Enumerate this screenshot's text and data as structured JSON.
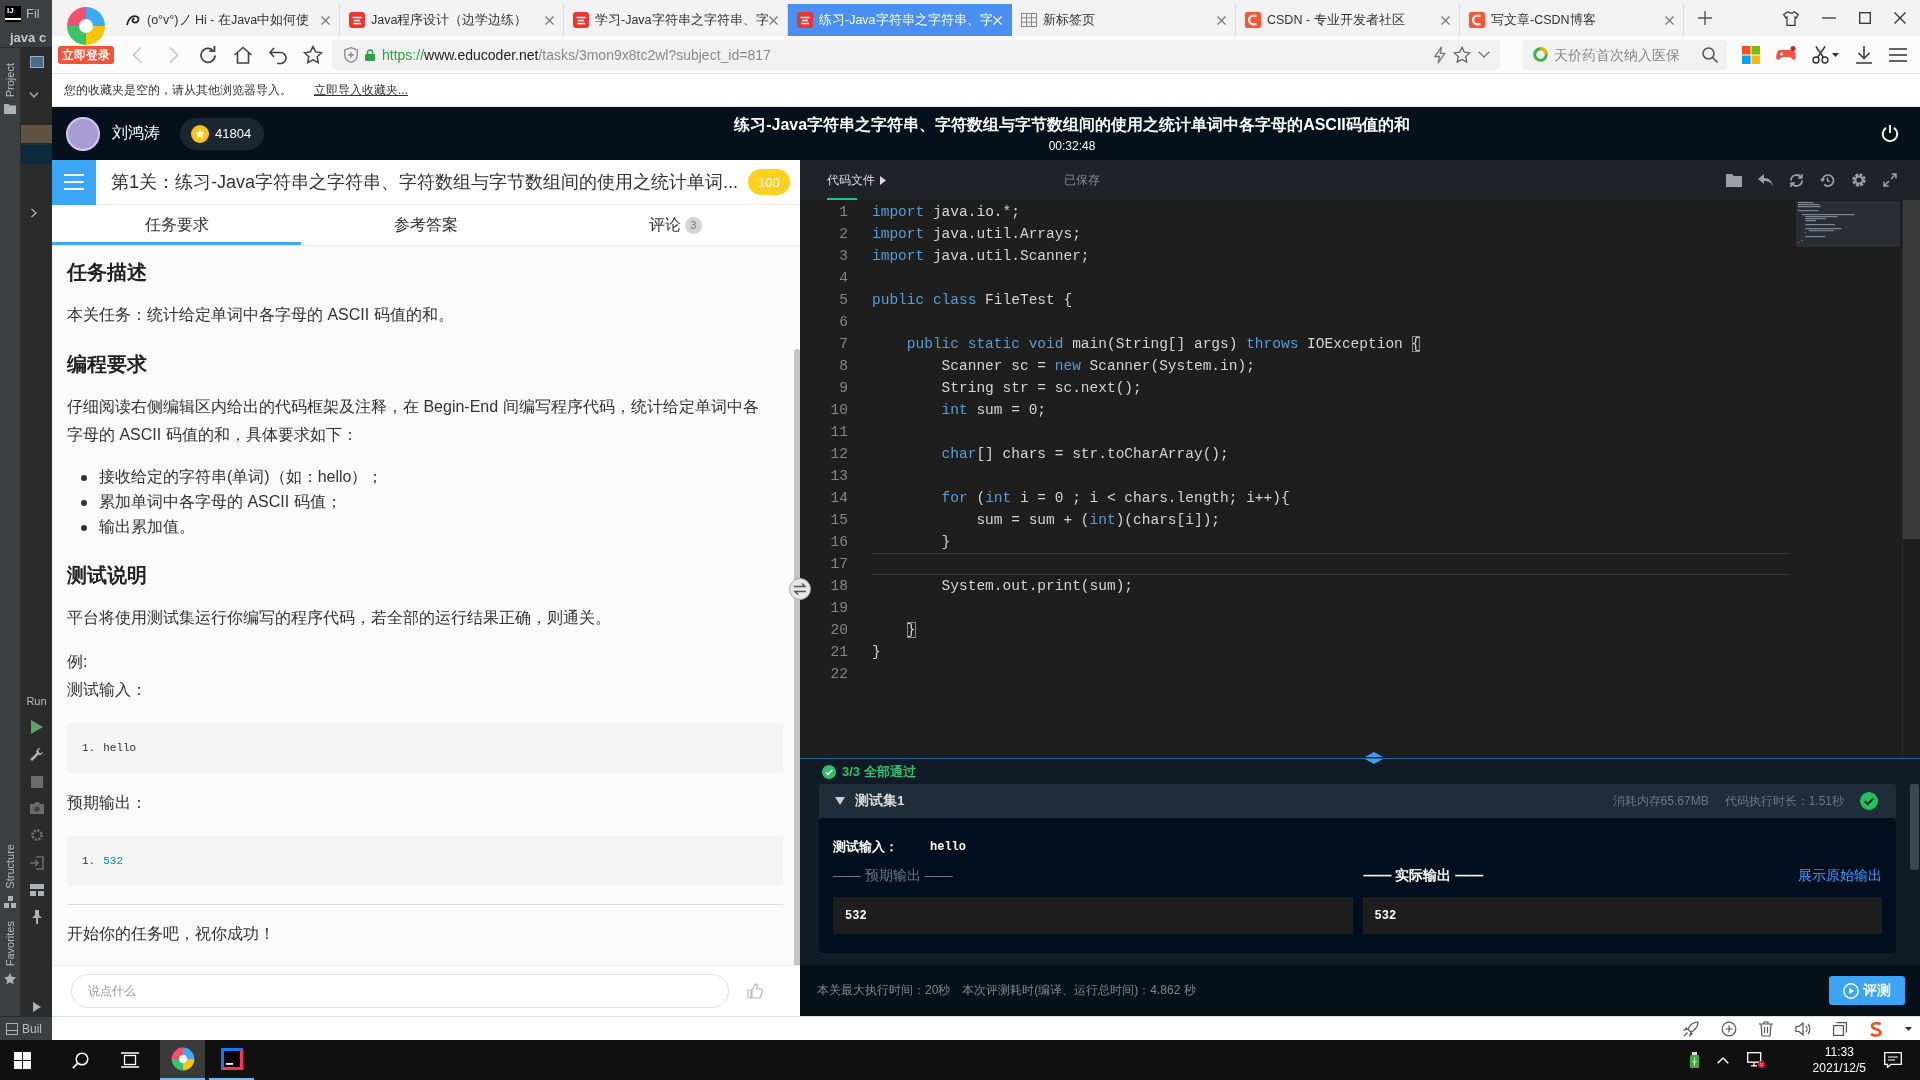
{
  "ide": {
    "logo": "IJ",
    "menu": "Fil",
    "project": "java c",
    "tool_tabs": [
      {
        "label": "Project",
        "kind": "top"
      },
      {
        "label": "Structure",
        "kind": "bottom"
      },
      {
        "label": "Favorites",
        "kind": "bottom"
      }
    ],
    "run_label": "Run",
    "build_label": "Buil"
  },
  "browser": {
    "login": "立即登录",
    "tabs": [
      {
        "title": "(o°v°)ノ Hi - 在Java中如何使",
        "kind": "blog",
        "selected": false
      },
      {
        "title": "Java程序设计（边学边练）",
        "kind": "news",
        "selected": false
      },
      {
        "title": "学习-Java字符串之字符串、字",
        "kind": "news",
        "selected": false
      },
      {
        "title": "练习-Java字符串之字符串、字",
        "kind": "news",
        "selected": true
      },
      {
        "title": "新标签页",
        "kind": "blank",
        "selected": false
      },
      {
        "title": "CSDN - 专业开发者社区",
        "kind": "csdn",
        "selected": false
      },
      {
        "title": "写文章-CSDN博客",
        "kind": "csdn",
        "selected": false
      }
    ],
    "navigation": {
      "back_disabled": true,
      "forward_disabled": true
    },
    "url": {
      "scheme": "https://",
      "host": "www.educoder.net",
      "path": "/tasks/3mon9x8tc2wl?subject_id=817"
    },
    "search": {
      "placeholder": "天价药首次纳入医保"
    },
    "bookmarks": {
      "message": "您的收藏夹是空的，请从其他浏览器导入。",
      "link": "立即导入收藏夹..."
    }
  },
  "header": {
    "user": "刘鸿涛",
    "coins": "41804",
    "title": "练习-Java字符串之字符串、字符数组与字节数组间的使用之统计单词中各字母的ASCII码值的和",
    "timer": "00:32:48"
  },
  "task": {
    "title": "第1关：练习-Java字符串之字符串、字符数组与字节数组间的使用之统计单词...",
    "score": "100",
    "tabs": [
      {
        "label": "任务要求",
        "selected": true
      },
      {
        "label": "参考答案",
        "selected": false
      },
      {
        "label": "评论",
        "count": "3",
        "selected": false
      }
    ],
    "content": [
      {
        "kind": "heading",
        "text": "任务描述"
      },
      {
        "kind": "paragraph",
        "text": "本关任务：统计给定单词中各字母的 ASCII 码值的和。"
      },
      {
        "kind": "heading",
        "text": "编程要求"
      },
      {
        "kind": "paragraph",
        "text": "仔细阅读右侧编辑区内给出的代码框架及注释，在 Begin-End 间编写程序代码，统计给定单词中各字母的 ASCII 码值的和，具体要求如下："
      },
      {
        "kind": "list",
        "items": [
          "接收给定的字符串(单词)（如：hello）；",
          "累加单词中各字母的 ASCII 码值；",
          "输出累加值。"
        ]
      },
      {
        "kind": "heading",
        "text": "测试说明"
      },
      {
        "kind": "paragraph",
        "text": "平台将使用测试集运行你编写的程序代码，若全部的运行结果正确，则通关。"
      },
      {
        "kind": "label",
        "text": "例:"
      },
      {
        "kind": "label",
        "text": "测试输入："
      },
      {
        "kind": "code",
        "lines": [
          {
            "number": "1.",
            "text": "hello",
            "kind": "plain"
          }
        ]
      },
      {
        "kind": "label",
        "text": "预期输出："
      },
      {
        "kind": "code",
        "lines": [
          {
            "number": "1.",
            "text": "532",
            "kind": "number"
          }
        ]
      },
      {
        "kind": "rule"
      },
      {
        "kind": "paragraph",
        "text": "开始你的任务吧，祝你成功！"
      }
    ],
    "comment": {
      "placeholder": "说点什么"
    }
  },
  "editor": {
    "file_tab": "代码文件",
    "save_status": "已保存",
    "lines": [
      {
        "number": "1",
        "current": false,
        "bracket_match": false,
        "tokens": [
          {
            "kind": "keyword",
            "text": "import"
          },
          {
            "kind": "plain",
            "text": " java.io.*;"
          }
        ]
      },
      {
        "number": "2",
        "current": false,
        "bracket_match": false,
        "tokens": [
          {
            "kind": "keyword",
            "text": "import"
          },
          {
            "kind": "plain",
            "text": " java.util.Arrays;"
          }
        ]
      },
      {
        "number": "3",
        "current": false,
        "bracket_match": false,
        "tokens": [
          {
            "kind": "keyword",
            "text": "import"
          },
          {
            "kind": "plain",
            "text": " java.util.Scanner;"
          }
        ]
      },
      {
        "number": "4",
        "current": false
      },
      {
        "number": "5",
        "current": false,
        "bracket_match": false,
        "tokens": [
          {
            "kind": "keyword",
            "text": "public class"
          },
          {
            "kind": "plain",
            "text": " FileTest {"
          }
        ]
      },
      {
        "number": "6",
        "current": false
      },
      {
        "number": "7",
        "current": false,
        "bracket_match": true,
        "tokens": [
          {
            "kind": "keyword",
            "text": "    public static void"
          },
          {
            "kind": "plain",
            "text": " main(String[] args) "
          },
          {
            "kind": "keyword",
            "text": "throws"
          },
          {
            "kind": "plain",
            "text": " IOException {"
          }
        ]
      },
      {
        "number": "8",
        "current": false,
        "bracket_match": false,
        "tokens": [
          {
            "kind": "plain",
            "text": "        Scanner sc = "
          },
          {
            "kind": "keyword",
            "text": "new"
          },
          {
            "kind": "plain",
            "text": " Scanner(System.in);"
          }
        ]
      },
      {
        "number": "9",
        "current": false,
        "bracket_match": false,
        "tokens": [
          {
            "kind": "plain",
            "text": "        String str = sc.next();"
          }
        ]
      },
      {
        "number": "10",
        "current": false,
        "bracket_match": false,
        "tokens": [
          {
            "kind": "keyword",
            "text": "        int"
          },
          {
            "kind": "plain",
            "text": " sum = 0;"
          }
        ]
      },
      {
        "number": "11",
        "current": false
      },
      {
        "number": "12",
        "current": false,
        "bracket_match": false,
        "tokens": [
          {
            "kind": "keyword",
            "text": "        char"
          },
          {
            "kind": "plain",
            "text": "[] chars = str.toCharArray();"
          }
        ]
      },
      {
        "number": "13",
        "current": false
      },
      {
        "number": "14",
        "current": false,
        "bracket_match": false,
        "tokens": [
          {
            "kind": "keyword",
            "text": "        for"
          },
          {
            "kind": "plain",
            "text": " ("
          },
          {
            "kind": "keyword",
            "text": "int"
          },
          {
            "kind": "plain",
            "text": " i = 0 ; i < chars.length; i++){"
          }
        ]
      },
      {
        "number": "15",
        "current": false,
        "bracket_match": false,
        "tokens": [
          {
            "kind": "plain",
            "text": "            sum = sum + ("
          },
          {
            "kind": "keyword",
            "text": "int"
          },
          {
            "kind": "plain",
            "text": ")(chars[i]);"
          }
        ]
      },
      {
        "number": "16",
        "current": false,
        "bracket_match": false,
        "tokens": [
          {
            "kind": "plain",
            "text": "        }"
          }
        ]
      },
      {
        "number": "17",
        "current": true
      },
      {
        "number": "18",
        "current": false,
        "bracket_match": false,
        "tokens": [
          {
            "kind": "plain",
            "text": "        System.out.print(sum);"
          }
        ]
      },
      {
        "number": "19",
        "current": false
      },
      {
        "number": "20",
        "current": false,
        "bracket_match": true,
        "tokens": [
          {
            "kind": "plain",
            "text": "    }"
          }
        ]
      },
      {
        "number": "21",
        "current": false,
        "bracket_match": false,
        "tokens": [
          {
            "kind": "plain",
            "text": "}"
          }
        ]
      },
      {
        "number": "22",
        "current": false
      }
    ]
  },
  "results": {
    "summary": "3/3 全部通过",
    "passed": true,
    "test_sets": [
      {
        "name": "测试集1",
        "expanded": true,
        "passed": true,
        "memory": "消耗内存65.67MB",
        "duration": "代码执行时长：1.51秒",
        "input_label": "测试输入：",
        "input": "hello",
        "expected_label": "—— 预期输出 ——",
        "actual_label": "—— 实际输出 ——",
        "raw_link": "展示原始输出",
        "expected": "532",
        "actual": "532"
      }
    ],
    "time_limit": "本关最大执行时间：20秒",
    "elapsed": "本次评测耗时(编译、运行总时间)：4.862 秒",
    "evaluate": "评测"
  },
  "taskbar": {
    "apps": [
      {
        "kind": "browser",
        "focused": true
      },
      {
        "kind": "ide",
        "focused": false
      }
    ],
    "time": "11:33",
    "date": "2021/12/5"
  }
}
